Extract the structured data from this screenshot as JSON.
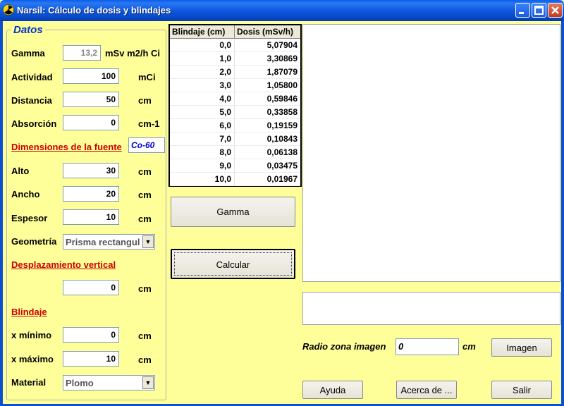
{
  "window": {
    "title": "Narsil: Cálculo de dosis y blindajes"
  },
  "datos": {
    "group_title": "Datos",
    "gamma": {
      "label": "Gamma",
      "value": "13,2",
      "unit": "mSv m2/h Ci"
    },
    "actividad": {
      "label": "Actividad",
      "value": "100",
      "unit": "mCi"
    },
    "distancia": {
      "label": "Distancia",
      "value": "50",
      "unit": "cm"
    },
    "absorcion": {
      "label": "Absorción",
      "value": "0",
      "unit": "cm-1"
    },
    "dimensiones_title": "Dimensiones de la fuente",
    "source_name": "Co-60",
    "alto": {
      "label": "Alto",
      "value": "30",
      "unit": "cm"
    },
    "ancho": {
      "label": "Ancho",
      "value": "20",
      "unit": "cm"
    },
    "espesor": {
      "label": "Espesor",
      "value": "10",
      "unit": "cm"
    },
    "geometria": {
      "label": "Geometría",
      "value": "Prisma rectangul"
    },
    "desplazamiento_title": "Desplazamiento vertical",
    "desplazamiento": {
      "value": "0",
      "unit": "cm"
    },
    "blindaje_title": "Blindaje",
    "x_minimo": {
      "label": "x mínimo",
      "value": "0",
      "unit": "cm"
    },
    "x_maximo": {
      "label": "x máximo",
      "value": "10",
      "unit": "cm"
    },
    "material": {
      "label": "Material",
      "value": "Plomo"
    }
  },
  "table": {
    "headers": [
      "Blindaje (cm)",
      "Dosis (mSv/h)"
    ],
    "rows": [
      [
        "0,0",
        "5,07904"
      ],
      [
        "1,0",
        "3,30869"
      ],
      [
        "2,0",
        "1,87079"
      ],
      [
        "3,0",
        "1,05800"
      ],
      [
        "4,0",
        "0,59846"
      ],
      [
        "5,0",
        "0,33858"
      ],
      [
        "6,0",
        "0,19159"
      ],
      [
        "7,0",
        "0,10843"
      ],
      [
        "8,0",
        "0,06138"
      ],
      [
        "9,0",
        "0,03475"
      ],
      [
        "10,0",
        "0,01967"
      ]
    ]
  },
  "buttons": {
    "gamma": "Gamma",
    "calcular": "Calcular",
    "imagen": "Imagen",
    "ayuda": "Ayuda",
    "acerca": "Acerca de ...",
    "salir": "Salir"
  },
  "radio": {
    "label": "Radio zona imagen",
    "value": "0",
    "unit": "cm"
  },
  "icons": {
    "app": "radiation-icon",
    "combo_arrow": "chevron-down-icon"
  },
  "colors": {
    "background": "#ffff99",
    "titlebar": "#0a5fe8",
    "section_title": "#cc0000",
    "group_title": "#0033cc"
  }
}
